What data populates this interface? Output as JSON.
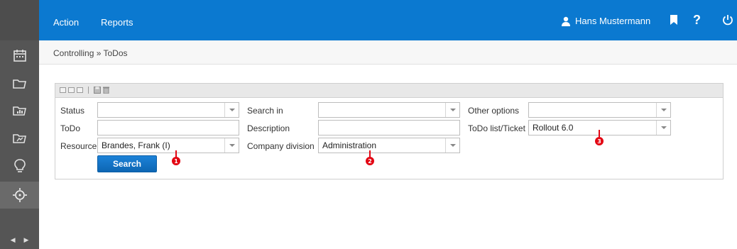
{
  "topbar": {
    "menu": [
      {
        "label": "Action"
      },
      {
        "label": "Reports"
      }
    ],
    "user_name": "Hans Mustermann",
    "help_label": "?"
  },
  "breadcrumb": {
    "text": "Controlling » ToDos"
  },
  "form": {
    "status": {
      "label": "Status",
      "value": ""
    },
    "todo": {
      "label": "ToDo",
      "value": ""
    },
    "resource": {
      "label": "Resource",
      "value": "Brandes, Frank (I)"
    },
    "search_in": {
      "label": "Search in",
      "value": ""
    },
    "description": {
      "label": "Description",
      "value": ""
    },
    "company_division": {
      "label": "Company division",
      "value": "Administration"
    },
    "other_options": {
      "label": "Other options",
      "value": ""
    },
    "todo_list_ticket": {
      "label": "ToDo list/Ticket",
      "value": "Rollout 6.0"
    },
    "search_button": "Search"
  },
  "markers": [
    "1",
    "2",
    "3"
  ],
  "colors": {
    "topbar": "#0b79d0",
    "sidebar": "#555555",
    "button": "#0d66b3",
    "marker": "#e30613"
  }
}
